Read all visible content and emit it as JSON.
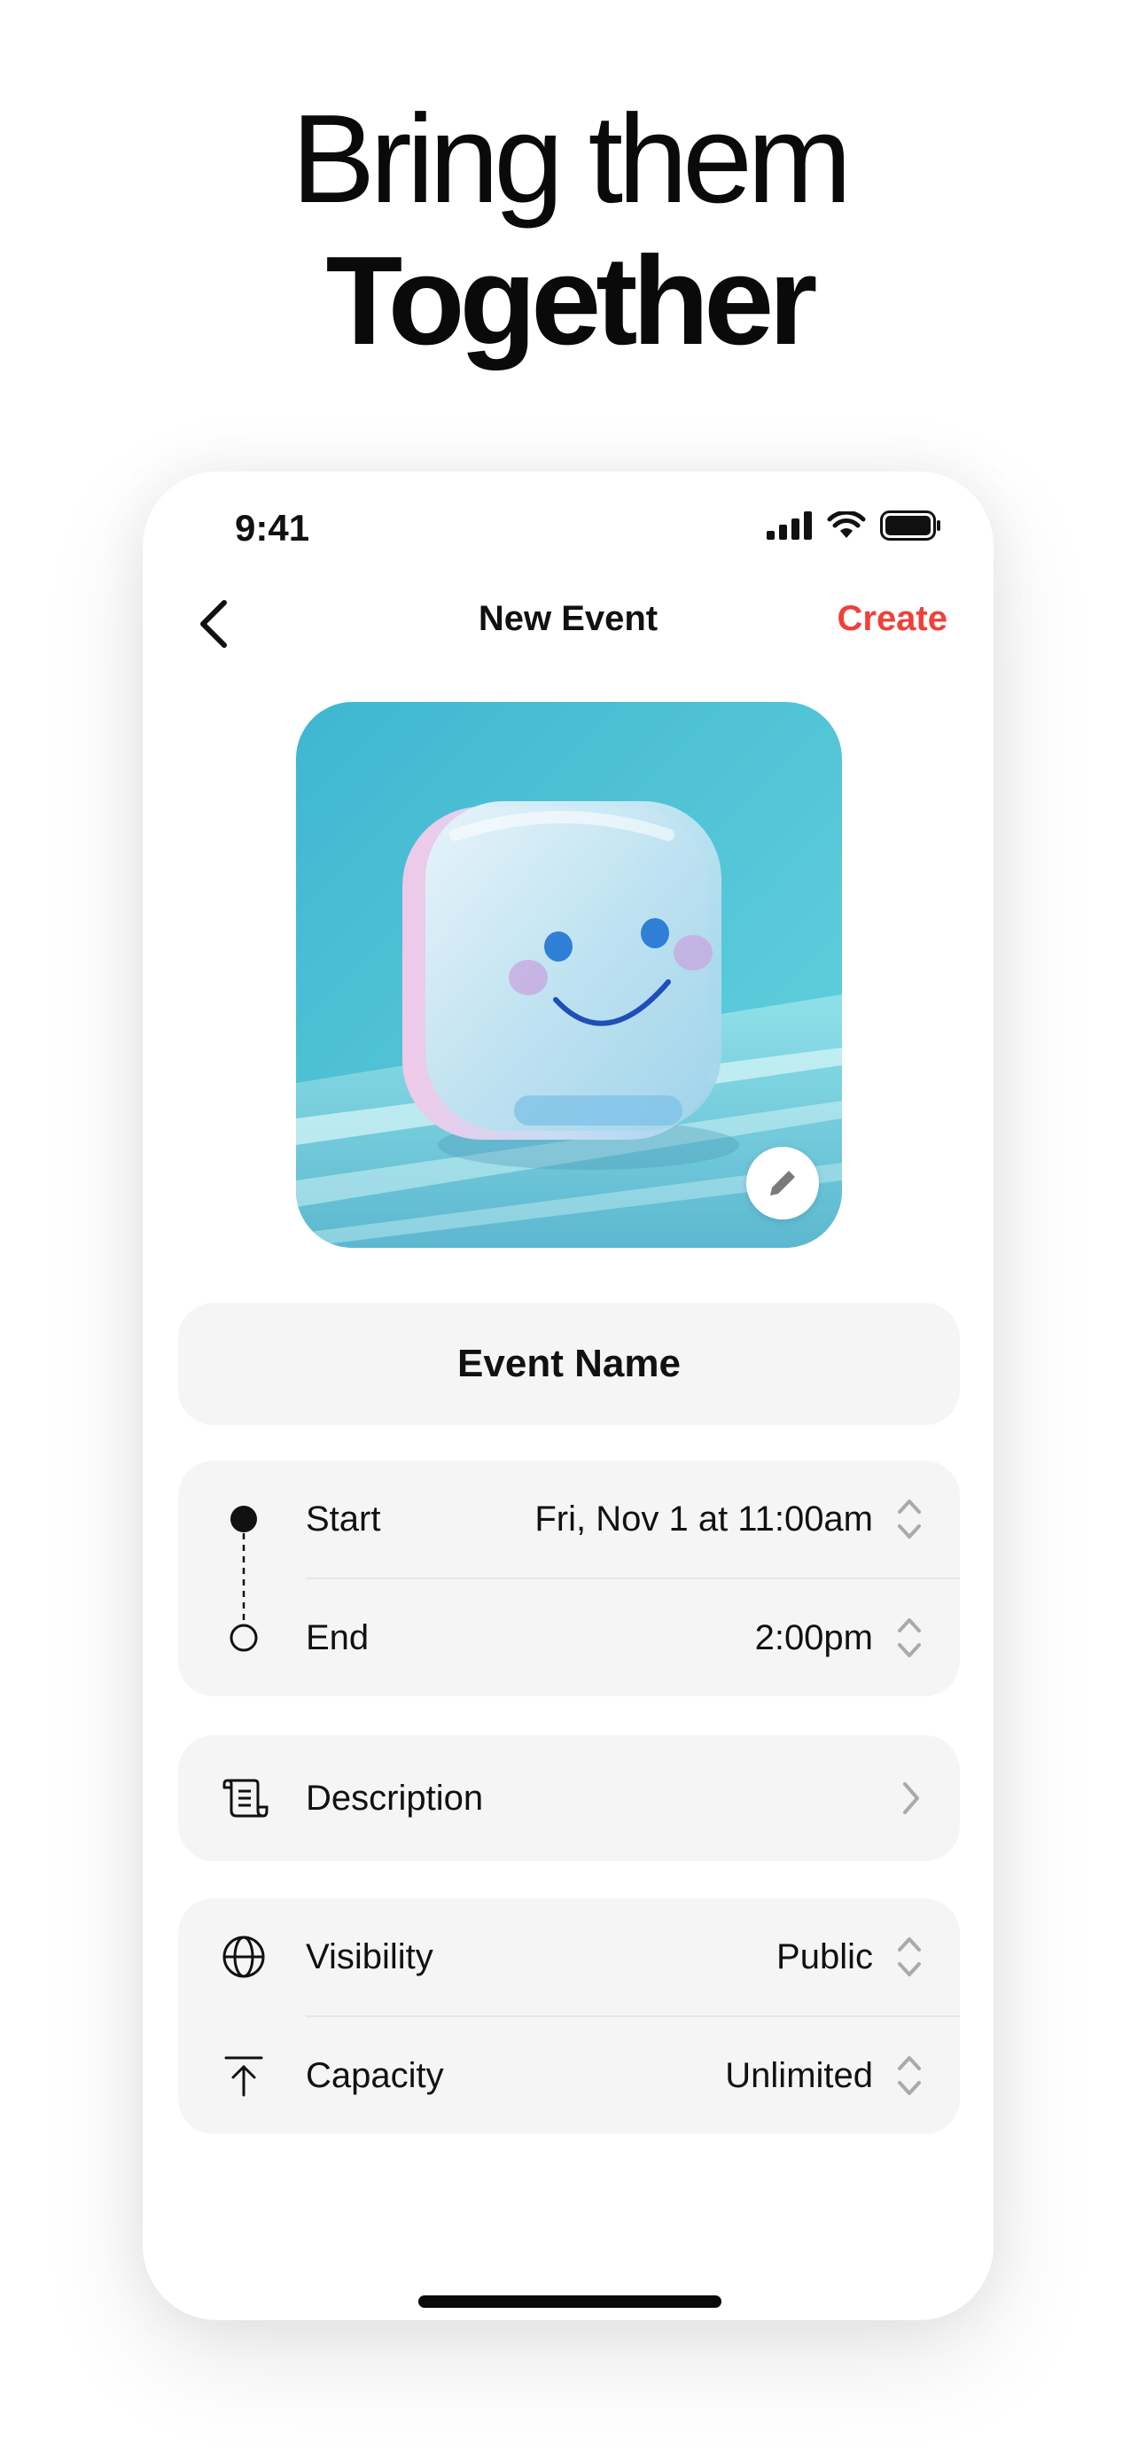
{
  "headline": {
    "line1": "Bring them",
    "line2": "Together"
  },
  "status_bar": {
    "time": "9:41"
  },
  "nav": {
    "title": "New Event",
    "create_label": "Create"
  },
  "event_name": {
    "placeholder": "Event Name"
  },
  "schedule": {
    "start_label": "Start",
    "start_value": "Fri, Nov 1 at 11:00am",
    "end_label": "End",
    "end_value": "2:00pm"
  },
  "description": {
    "label": "Description"
  },
  "settings": {
    "visibility_label": "Visibility",
    "visibility_value": "Public",
    "capacity_label": "Capacity",
    "capacity_value": "Unlimited"
  },
  "colors": {
    "accent": "#f0403a",
    "card_bg": "#f5f5f5",
    "cover_sky": "#4fc3d6"
  }
}
